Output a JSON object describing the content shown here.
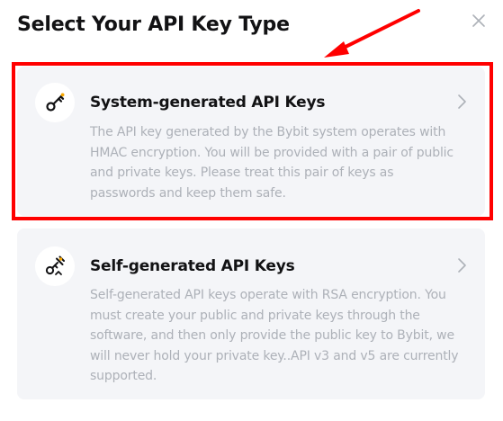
{
  "modal": {
    "title": "Select Your API Key Type",
    "close_icon": "close-icon"
  },
  "options": [
    {
      "title": "System-generated API Keys",
      "description": "The API key generated by the Bybit system operates with HMAC encryption. You will be provided with a pair of public and private keys. Please treat this pair of keys as passwords and keep them safe.",
      "icon": "key-icon",
      "chevron_icon": "chevron-right-icon"
    },
    {
      "title": "Self-generated API Keys",
      "description": "Self-generated API keys operate with RSA encryption. You must create your public and private keys through the software, and then only provide the public key to Bybit, we will never hold your private key..API v3 and v5 are currently supported.",
      "icon": "key-pen-icon",
      "chevron_icon": "chevron-right-icon"
    }
  ],
  "annotation": {
    "highlight_color": "#ff0000"
  },
  "colors": {
    "card_background": "#f4f5f8",
    "title_text": "#121214",
    "description_text": "#adb1b8"
  }
}
